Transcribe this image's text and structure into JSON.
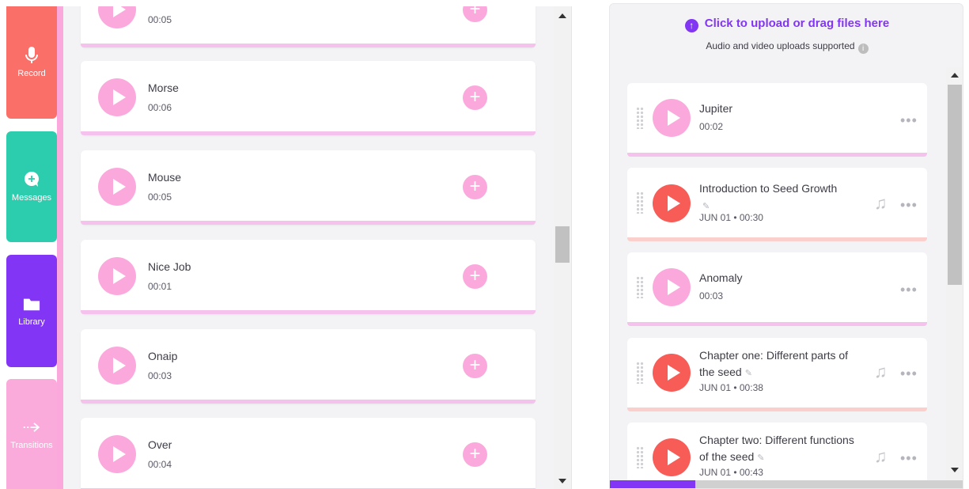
{
  "sidebar": {
    "record": "Record",
    "messages": "Messages",
    "library": "Library",
    "transitions": "Transitions"
  },
  "left_list": {
    "partial_item": {
      "duration": "00:05"
    },
    "items": [
      {
        "title": "Morse",
        "duration": "00:06"
      },
      {
        "title": "Mouse",
        "duration": "00:05"
      },
      {
        "title": "Nice Job",
        "duration": "00:01"
      },
      {
        "title": "Onaip",
        "duration": "00:03"
      },
      {
        "title": "Over",
        "duration": "00:04"
      }
    ],
    "add_symbol": "+"
  },
  "upload": {
    "title": "Click to upload or drag files here",
    "subtitle": "Audio and video uploads supported",
    "info_symbol": "i"
  },
  "tracks": [
    {
      "title": "Jupiter",
      "meta": "00:02",
      "style": "pink"
    },
    {
      "title": "Introduction to Seed Growth",
      "meta": "JUN 01 • 00:30",
      "style": "red"
    },
    {
      "title": "Anomaly",
      "meta": "00:03",
      "style": "pink"
    },
    {
      "title": "Chapter one: Different parts of the seed",
      "meta": "JUN 01 • 00:38",
      "style": "red"
    },
    {
      "title": "Chapter two: Different functions of the seed",
      "meta": "JUN 01 • 00:43",
      "style": "red"
    }
  ],
  "upload_progress_percent": 24,
  "colors": {
    "record": "#fb6f69",
    "messages": "#2ccdae",
    "library": "#8235f5",
    "transitions": "#fbaadc",
    "accent": "#8235f5"
  },
  "icons": {
    "record": "microphone-icon",
    "messages": "chat-plus-icon",
    "library": "folder-icon",
    "transitions": "arrow-right-dashed-icon",
    "upload": "upload-arrow-icon",
    "info": "info-icon",
    "grip": "drag-handle-icon",
    "more": "more-dots-icon",
    "music": "music-note-icon",
    "pencil": "pencil-icon"
  },
  "more_symbol": "•••",
  "pencil_symbol": "✎",
  "music_symbol": "♫"
}
